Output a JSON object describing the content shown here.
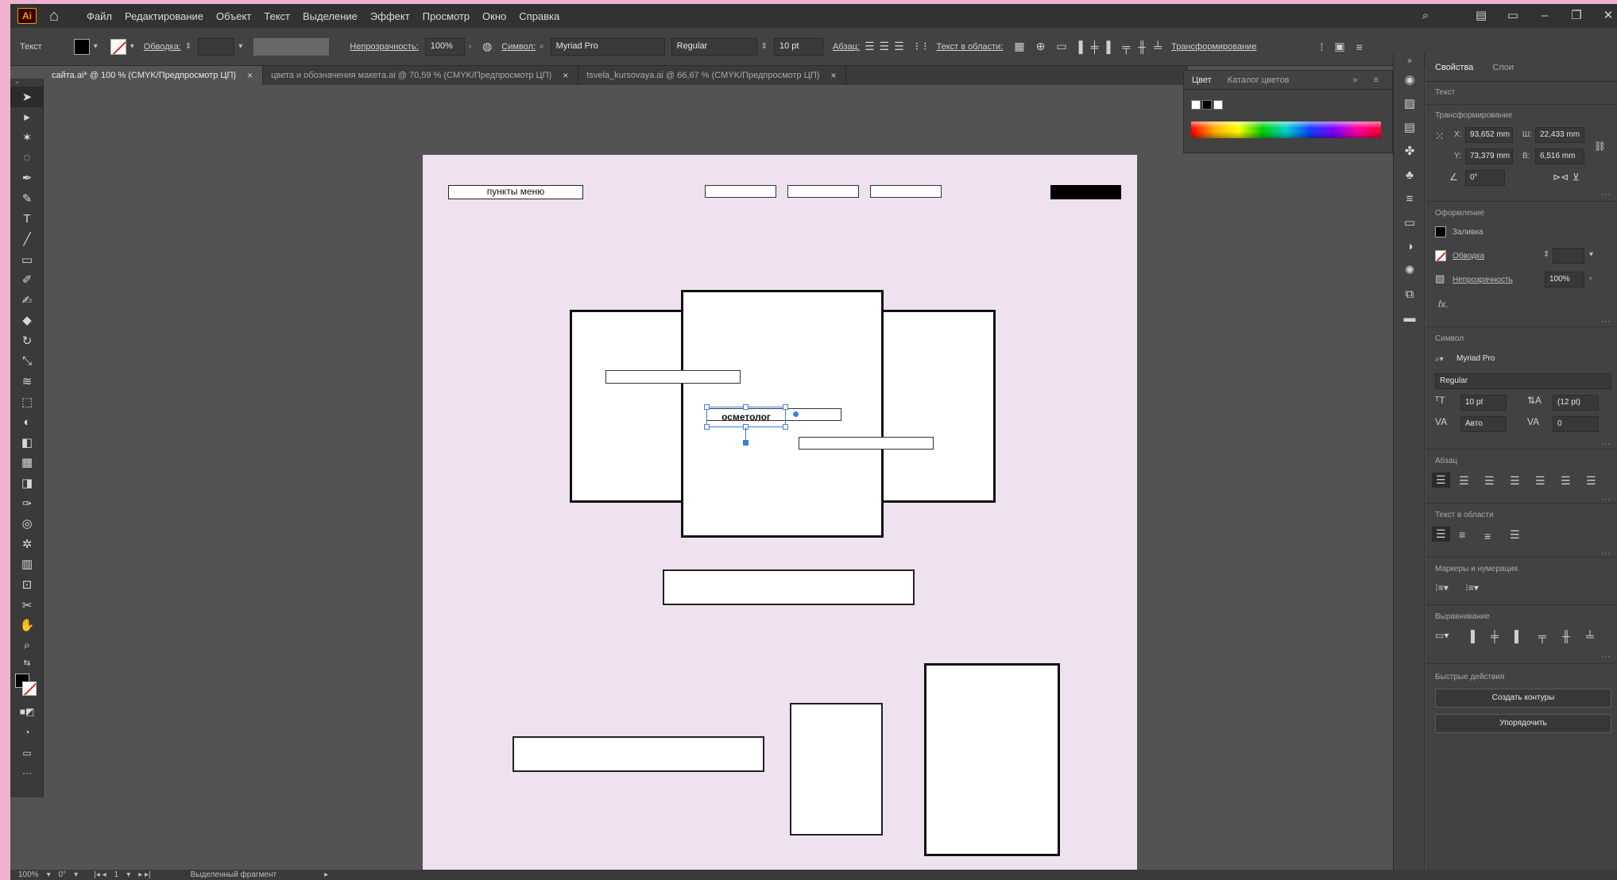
{
  "app": {
    "logo": "Ai"
  },
  "menu": [
    "Файл",
    "Редактирование",
    "Объект",
    "Текст",
    "Выделение",
    "Эффект",
    "Просмотр",
    "Окно",
    "Справка"
  ],
  "control": {
    "selection_type": "Текст",
    "stroke_label": "Обводка:",
    "opacity_label": "Непрозрачность:",
    "opacity_value": "100%",
    "char_label": "Символ:",
    "font": "Myriad Pro",
    "style": "Regular",
    "size": "10 pt",
    "para_label": "Абзац:",
    "area_text_label": "Текст в области:",
    "transform_label": "Трансформирование"
  },
  "tabs": [
    {
      "label": "сайта.ai* @ 100 % (CMYK/Предпросмотр ЦП)"
    },
    {
      "label": "цвета и обозначения макета.ai @ 70,59 % (CMYK/Предпросмотр ЦП)"
    },
    {
      "label": "tsvela_kursovaya.ai @ 66,67 % (CMYK/Предпросмотр ЦП)"
    }
  ],
  "artboard": {
    "menu_items_label": "пункты меню",
    "selected_text": "осметолог"
  },
  "color_panel": {
    "tab_color": "Цвет",
    "tab_catalog": "Каталог цветов"
  },
  "properties": {
    "tab_props": "Свойства",
    "tab_layers": "Слои",
    "section_object": "Текст",
    "section_transform": "Трансформирование",
    "x_label": "X:",
    "x_value": "93,652 mm",
    "y_label": "Y:",
    "y_value": "73,379 mm",
    "w_label": "Ш:",
    "w_value": "22,433 mm",
    "h_label": "В:",
    "h_value": "6,516 mm",
    "angle_value": "0°",
    "section_appearance": "Оформление",
    "fill_label": "Заливка",
    "stroke_label": "Обводка",
    "opacity_label": "Непрозрачность",
    "opacity_value": "100%",
    "fx_label": "fx.",
    "section_char": "Символ",
    "font": "Myriad Pro",
    "style": "Regular",
    "size": "10 pt",
    "leading": "(12 pt)",
    "kerning": "Авто",
    "tracking": "0",
    "section_para": "Абзац",
    "section_area": "Текст в области",
    "section_bullets": "Маркеры и нумерация",
    "section_align": "Выравнивание",
    "section_quick": "Быстрые действия",
    "btn_outlines": "Создать контуры",
    "btn_arrange": "Упорядочить"
  },
  "status": {
    "zoom": "100%",
    "angle": "0°",
    "page": "1",
    "mode": "Выделенный фрагмент"
  }
}
